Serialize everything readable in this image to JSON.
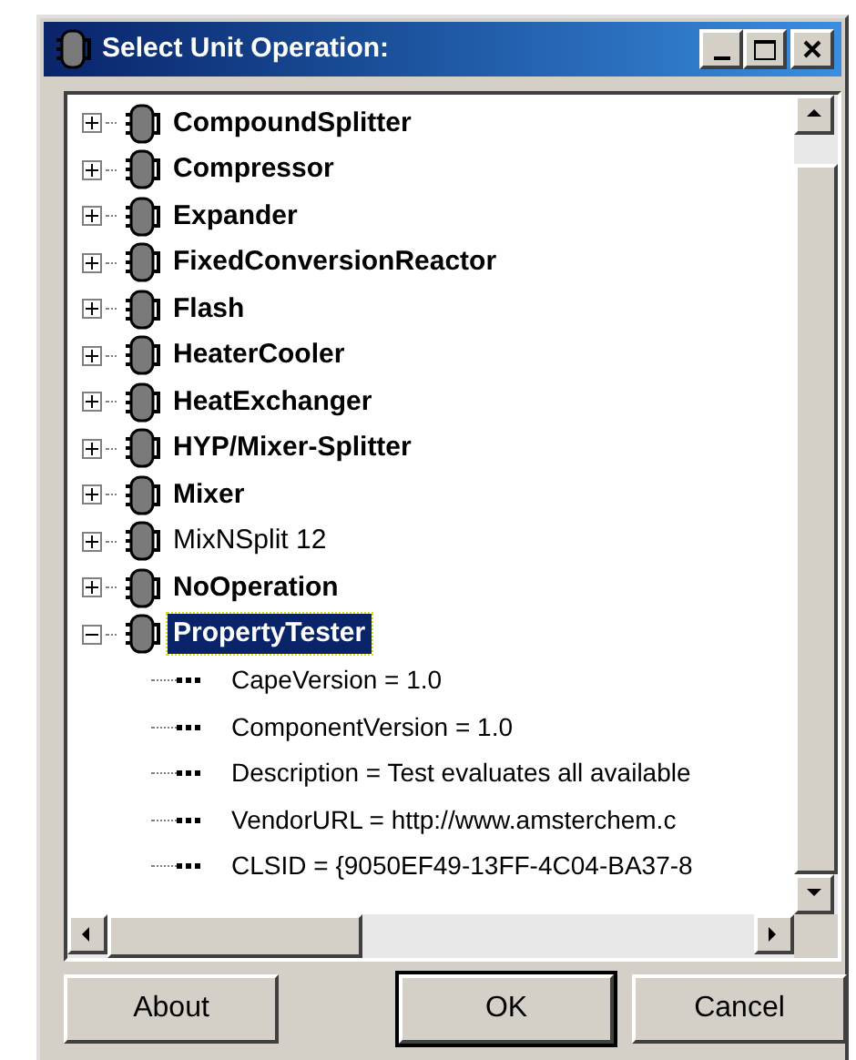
{
  "window": {
    "title": "Select Unit Operation:"
  },
  "tree": [
    {
      "label": "CompoundSplitter",
      "bold": true,
      "expanded": false,
      "selected": false
    },
    {
      "label": "Compressor",
      "bold": true,
      "expanded": false,
      "selected": false
    },
    {
      "label": "Expander",
      "bold": true,
      "expanded": false,
      "selected": false
    },
    {
      "label": "FixedConversionReactor",
      "bold": true,
      "expanded": false,
      "selected": false
    },
    {
      "label": "Flash",
      "bold": true,
      "expanded": false,
      "selected": false
    },
    {
      "label": "HeaterCooler",
      "bold": true,
      "expanded": false,
      "selected": false
    },
    {
      "label": "HeatExchanger",
      "bold": true,
      "expanded": false,
      "selected": false
    },
    {
      "label": "HYP/Mixer-Splitter",
      "bold": true,
      "expanded": false,
      "selected": false
    },
    {
      "label": "Mixer",
      "bold": true,
      "expanded": false,
      "selected": false
    },
    {
      "label": "MixNSplit 12",
      "bold": false,
      "expanded": false,
      "selected": false
    },
    {
      "label": "NoOperation",
      "bold": true,
      "expanded": false,
      "selected": false
    },
    {
      "label": "PropertyTester",
      "bold": true,
      "expanded": true,
      "selected": true,
      "children": [
        {
          "label": "CapeVersion = 1.0"
        },
        {
          "label": "ComponentVersion = 1.0"
        },
        {
          "label": "Description = Test evaluates all available"
        },
        {
          "label": "VendorURL = http://www.amsterchem.c"
        },
        {
          "label": "CLSID = {9050EF49-13FF-4C04-BA37-8"
        }
      ]
    }
  ],
  "buttons": [
    {
      "label": "About",
      "default": false
    },
    {
      "label": "OK",
      "default": true
    },
    {
      "label": "Cancel",
      "default": false
    }
  ]
}
